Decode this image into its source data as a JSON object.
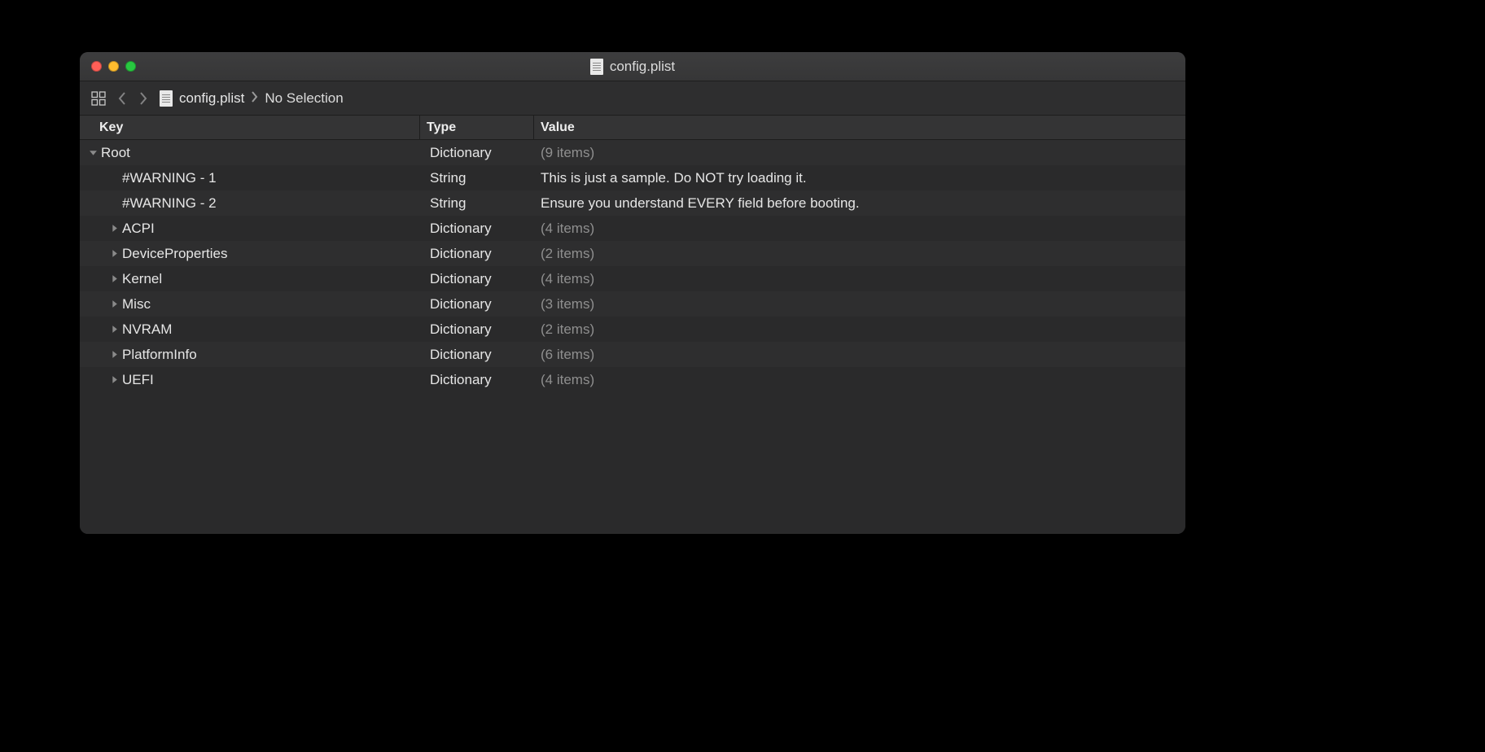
{
  "window": {
    "title": "config.plist"
  },
  "toolbar": {
    "breadcrumb_file": "config.plist",
    "breadcrumb_selection": "No Selection"
  },
  "headers": {
    "key": "Key",
    "type": "Type",
    "value": "Value"
  },
  "rows": [
    {
      "key": "Root",
      "type": "Dictionary",
      "value": "(9 items)",
      "indent": 0,
      "disclosure": "down",
      "value_muted": true
    },
    {
      "key": "#WARNING - 1",
      "type": "String",
      "value": "This is just a sample. Do NOT try loading it.",
      "indent": 1,
      "disclosure": "none",
      "value_muted": false
    },
    {
      "key": "#WARNING - 2",
      "type": "String",
      "value": "Ensure you understand EVERY field before booting.",
      "indent": 1,
      "disclosure": "none",
      "value_muted": false
    },
    {
      "key": "ACPI",
      "type": "Dictionary",
      "value": "(4 items)",
      "indent": 1,
      "disclosure": "right",
      "value_muted": true
    },
    {
      "key": "DeviceProperties",
      "type": "Dictionary",
      "value": "(2 items)",
      "indent": 1,
      "disclosure": "right",
      "value_muted": true
    },
    {
      "key": "Kernel",
      "type": "Dictionary",
      "value": "(4 items)",
      "indent": 1,
      "disclosure": "right",
      "value_muted": true
    },
    {
      "key": "Misc",
      "type": "Dictionary",
      "value": "(3 items)",
      "indent": 1,
      "disclosure": "right",
      "value_muted": true
    },
    {
      "key": "NVRAM",
      "type": "Dictionary",
      "value": "(2 items)",
      "indent": 1,
      "disclosure": "right",
      "value_muted": true
    },
    {
      "key": "PlatformInfo",
      "type": "Dictionary",
      "value": "(6 items)",
      "indent": 1,
      "disclosure": "right",
      "value_muted": true
    },
    {
      "key": "UEFI",
      "type": "Dictionary",
      "value": "(4 items)",
      "indent": 1,
      "disclosure": "right",
      "value_muted": true
    }
  ]
}
